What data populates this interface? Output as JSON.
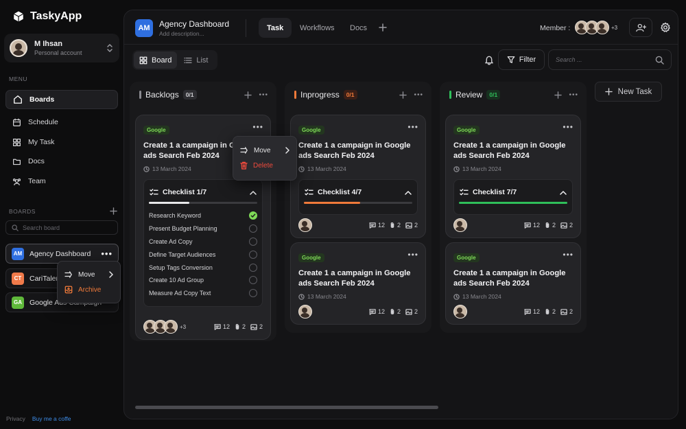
{
  "app": {
    "name": "TaskyApp"
  },
  "account": {
    "name": "M Ihsan",
    "subtitle": "Personal account"
  },
  "menu": {
    "label": "MENU",
    "items": [
      {
        "label": "Boards",
        "icon": "home-icon",
        "active": true
      },
      {
        "label": "Schedule",
        "icon": "calendar-icon"
      },
      {
        "label": "My Task",
        "icon": "grid-icon"
      },
      {
        "label": "Docs",
        "icon": "folder-icon"
      },
      {
        "label": "Team",
        "icon": "team-icon"
      }
    ]
  },
  "boards": {
    "label": "BOARDS",
    "search_placeholder": "Search board",
    "items": [
      {
        "initials": "AM",
        "name": "Agency Dashboard",
        "color": "#2f6fe0"
      },
      {
        "initials": "CT",
        "name": "CariTalent",
        "color": "#f07a4a"
      },
      {
        "initials": "GA",
        "name": "Google Ads Campaign",
        "color": "#5fb83a"
      }
    ],
    "context_menu": {
      "move": "Move",
      "archive": "Archive"
    }
  },
  "footer": {
    "privacy": "Privacy",
    "coffee": "Buy me a coffe"
  },
  "header": {
    "logo": "AM",
    "title": "Agency Dashboard",
    "description_placeholder": "Add description...",
    "tabs": [
      {
        "label": "Task",
        "active": true
      },
      {
        "label": "Workflows"
      },
      {
        "label": "Docs"
      }
    ],
    "member_label": "Member :",
    "member_extra": "+3"
  },
  "toolbar": {
    "view_board": "Board",
    "view_list": "List",
    "filter": "Filter",
    "search_placeholder": "Search ..."
  },
  "card_menu": {
    "move": "Move",
    "delete": "Delete"
  },
  "new_task": "New Task",
  "columns": [
    {
      "name": "Backlogs",
      "count": "0/1",
      "color": "#8a8a90",
      "cards": [
        {
          "tag": "Google",
          "title": "Create 1 a campaign in Google ads Search Feb 2024",
          "date": "13 March 2024",
          "checklist_label": "Checklist 1/7",
          "progress": 0.375,
          "progress_color": "#e8e8ea",
          "tasks": [
            {
              "label": "Research Keyword",
              "done": true
            },
            {
              "label": "Present Budget Planning",
              "done": false
            },
            {
              "label": "Create Ad Copy",
              "done": false
            },
            {
              "label": "Define Target Audiences",
              "done": false
            },
            {
              "label": "Setup Tags Conversion",
              "done": false
            },
            {
              "label": "Create 10 Ad Group",
              "done": false
            },
            {
              "label": "Measure Ad Copy Text",
              "done": false
            }
          ],
          "extra_members": "+3",
          "comments": "12",
          "attachments": "2",
          "images": "2"
        }
      ]
    },
    {
      "name": "Inprogress",
      "count": "0/1",
      "color": "#f07a3a",
      "cards": [
        {
          "tag": "Google",
          "title": "Create 1 a campaign in Google ads Search Feb 2024",
          "date": "13 March 2024",
          "checklist_label": "Checklist 4/7",
          "progress": 0.52,
          "progress_color": "#f07a3a",
          "comments": "12",
          "attachments": "2",
          "images": "2"
        },
        {
          "tag": "Google",
          "title": "Create 1 a campaign in Google ads Search Feb 2024",
          "date": "13 March 2024",
          "comments": "12",
          "attachments": "2",
          "images": "2"
        }
      ]
    },
    {
      "name": "Review",
      "count": "0/1",
      "color": "#2fbf5a",
      "cards": [
        {
          "tag": "Google",
          "title": "Create 1 a campaign in Google ads Search Feb 2024",
          "date": "13 March 2024",
          "checklist_label": "Checklist 7/7",
          "progress": 1.0,
          "progress_color": "#2fbf5a",
          "comments": "12",
          "attachments": "2",
          "images": "2"
        },
        {
          "tag": "Google",
          "title": "Create 1 a campaign in Google ads Search Feb 2024",
          "date": "13 March 2024",
          "comments": "12",
          "attachments": "2",
          "images": "2"
        }
      ]
    }
  ]
}
